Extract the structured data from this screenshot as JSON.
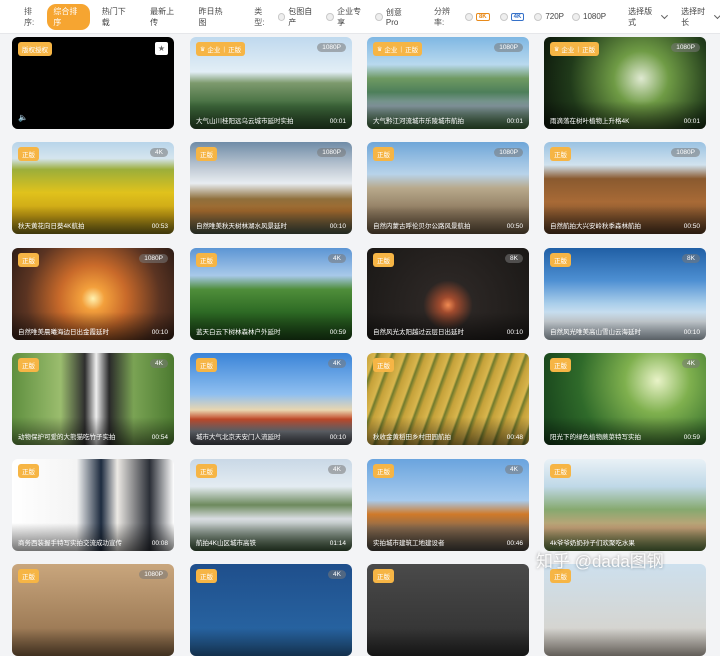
{
  "filters": {
    "sort_label": "排序:",
    "sort_options": [
      "综合排序",
      "热门下载",
      "最新上传",
      "昨日热图"
    ],
    "type_label": "类型:",
    "type_options": [
      "包图自产",
      "企业专享",
      "创意Pro"
    ],
    "resolution_label": "分辨率:",
    "resolution_tags": [
      "8K",
      "4K"
    ],
    "resolution_options": [
      "720P",
      "1080P"
    ],
    "format_dropdown": "选择版式",
    "duration_dropdown": "选择时长"
  },
  "colors": {
    "accent": "#f6a531",
    "badge": "#f6b545"
  },
  "cards": [
    {
      "badge": "版权授权",
      "crown": false,
      "enterprise": false,
      "res": "",
      "caption": "",
      "duration": "",
      "playing": true,
      "bg": "linear-gradient(#000,#000)"
    },
    {
      "badge": "正版",
      "crown": true,
      "enterprise": true,
      "res": "1080P",
      "caption": "大气山川桂阳远乌云城市延时实拍",
      "duration": "00:01",
      "bg": "linear-gradient(#bfd9ee 0%,#e2eef6 38%,#7d9a6d 50%,#3f6a3c 75%,#2d4f2b 100%)"
    },
    {
      "badge": "正版",
      "crown": true,
      "enterprise": true,
      "res": "1080P",
      "caption": "大气黔江河流城市乐陵城市航拍",
      "duration": "00:01",
      "bg": "linear-gradient(#7fb7e3 0%,#b9d9ee 30%,#6f9a62 45%,#4d7f5a 60%,#8a9ea5 75%,#3d6a3a 100%)"
    },
    {
      "badge": "正版",
      "crown": true,
      "enterprise": true,
      "res": "1080P",
      "caption": "雨滴落在树叶植物上升格4K",
      "duration": "00:01",
      "bg": "radial-gradient(circle at 60% 45%, #dfe9d1 0%, #6f9b45 25%, #203a1a 65%, #0b140a 100%)"
    },
    {
      "badge": "正版",
      "crown": false,
      "enterprise": false,
      "res": "4K",
      "caption": "秋天黄花向日葵4K航拍",
      "duration": "00:53",
      "bg": "linear-gradient(#b8d4ea 0%,#d5e5ee 18%,#9cae3a 30%,#e0c21c 55%,#c79f14 80%,#8a7a1a 100%)"
    },
    {
      "badge": "正版",
      "crown": false,
      "enterprise": false,
      "res": "1080P",
      "caption": "自然唯美秋天树林湖水风景延时",
      "duration": "00:10",
      "bg": "linear-gradient(#6f8ca7 0%,#c5ced8 30%,#e8edf1 45%,#8f6f3c 62%,#a56b2e 75%,#4e5a4a 100%)"
    },
    {
      "badge": "正版",
      "crown": false,
      "enterprise": false,
      "res": "1080P",
      "caption": "自然内蒙古呼伦贝尔公路风景航拍",
      "duration": "00:50",
      "bg": "linear-gradient(#6fa6d8 0%,#b8d3ea 35%,#b8a98c 50%,#8e7a5f 75%,#6d5a43 100%)"
    },
    {
      "badge": "正版",
      "crown": false,
      "enterprise": false,
      "res": "1080P",
      "caption": "自然航拍大兴安岭秋季森林航拍",
      "duration": "00:50",
      "bg": "linear-gradient(#9ac2e2 0%,#d1e2ee 25%,#8a5a2f 40%,#a86a36 65%,#5b3c24 100%)"
    },
    {
      "badge": "正版",
      "crown": false,
      "enterprise": false,
      "res": "1080P",
      "caption": "自然唯美晨曦海边日出金霞延时",
      "duration": "00:10",
      "bg": "radial-gradient(circle at 50% 55%, #fff2b0 0%, #f3a03c 12%, #c96a2a 35%, #5b3422 70%, #2d1c16 100%)"
    },
    {
      "badge": "正版",
      "crown": false,
      "enterprise": false,
      "res": "4K",
      "caption": "蓝天白云下树林森林户外延时",
      "duration": "00:59",
      "bg": "linear-gradient(#5c95d4 0%,#a8c9ea 30%,#4f8e3a 45%,#2d6a24 70%,#1d4a18 100%)"
    },
    {
      "badge": "正版",
      "crown": false,
      "enterprise": false,
      "res": "8K",
      "caption": "自然风光太阳越过云层日出延时",
      "duration": "00:10",
      "bg": "radial-gradient(circle at 50% 62%, #f18a52 0%, #a14b2e 8%, #2b2624 25%, #1a1816 100%)"
    },
    {
      "badge": "正版",
      "crown": false,
      "enterprise": false,
      "res": "8K",
      "caption": "自然风光唯美高山雪山云海延时",
      "duration": "00:10",
      "bg": "linear-gradient(#205fa5 0%,#4d8fd2 35%,#a8cdea 60%,#e6eef4 80%,#c6d5e0 100%)"
    },
    {
      "badge": "正版",
      "crown": false,
      "enterprise": false,
      "res": "4K",
      "caption": "动物保护可爱的大熊猫吃竹子实拍",
      "duration": "00:54",
      "bg": "linear-gradient(90deg,#5f8f3f 0%,#9bbd6e 30%,#2f2f2f 45%,#eeeeee 52%,#2a2a2a 60%,#7aa354 75%,#4c7a30 100%)"
    },
    {
      "badge": "正版",
      "crown": false,
      "enterprise": false,
      "res": "4K",
      "caption": "城市大气北京天安门人流延时",
      "duration": "00:10",
      "bg": "linear-gradient(#3a84d8 0%,#8fbff0 45%,#e9d6b0 62%,#c34a2a 72%,#7a7e86 85%,#4a4d55 100%)"
    },
    {
      "badge": "正版",
      "crown": false,
      "enterprise": false,
      "res": "",
      "caption": "秋收金黄稻田乡村田园航拍",
      "duration": "00:48",
      "bg": "repeating-linear-gradient(110deg,#c6a23a 0px,#d9b64e 8px,#6f7a2c 10px,#c6a23a 14px)"
    },
    {
      "badge": "正版",
      "crown": false,
      "enterprise": false,
      "res": "4K",
      "caption": "阳光下的绿色植物蕨菜特写实拍",
      "duration": "00:59",
      "bg": "radial-gradient(circle at 70% 30%, #e9f3c8 0%, #7fb04e 25%, #2f6a2a 60%, #123a18 100%)"
    },
    {
      "badge": "正版",
      "crown": false,
      "enterprise": false,
      "res": "",
      "caption": "商务西装握手特写实拍交流成功宣传",
      "duration": "00:08",
      "bg": "linear-gradient(90deg,#ffffff 0%,#f4f4f4 40%,#1d2b3f 55%,#ece9e4 65%,#2b2f37 85%,#ffffff 100%)"
    },
    {
      "badge": "正版",
      "crown": false,
      "enterprise": false,
      "res": "4K",
      "caption": "航拍4K山区城市高铁",
      "duration": "01:14",
      "bg": "linear-gradient(#c9d8e6 0%,#e4ecf2 30%,#6d8a5d 50%,#d9dde2 65%,#3e5a3a 100%)"
    },
    {
      "badge": "正版",
      "crown": false,
      "enterprise": false,
      "res": "4K",
      "caption": "实拍城市建筑工地建设者",
      "duration": "00:46",
      "bg": "linear-gradient(#6aa4de 0%,#a7cbee 45%,#d07a2a 60%,#8a6b4e 75%,#4a4640 100%)"
    },
    {
      "badge": "正版",
      "crown": false,
      "enterprise": false,
      "res": "",
      "caption": "4k爷爷奶奶孙子们欢聚吃水果",
      "duration": "",
      "bg": "linear-gradient(#e9f1f6 0%,#bfd8e7 30%,#86a96f 55%,#c8a47a 75%,#5e7d43 100%)"
    },
    {
      "badge": "正版",
      "crown": false,
      "enterprise": false,
      "res": "1080P",
      "caption": "",
      "duration": "",
      "bg": "linear-gradient(#c9a67d,#8c6a47)"
    },
    {
      "badge": "正版",
      "crown": false,
      "enterprise": false,
      "res": "4K",
      "caption": "",
      "duration": "",
      "bg": "linear-gradient(#1f4f8c,#2a6aa8)"
    },
    {
      "badge": "正版",
      "crown": false,
      "enterprise": false,
      "res": "",
      "caption": "",
      "duration": "",
      "bg": "linear-gradient(#4a4a4a,#2e2e2e)"
    },
    {
      "badge": "正版",
      "crown": false,
      "enterprise": false,
      "res": "",
      "caption": "",
      "duration": "",
      "bg": "linear-gradient(#cde0ee,#d9d0c4)"
    }
  ],
  "watermark": "知乎 @dada图钢"
}
